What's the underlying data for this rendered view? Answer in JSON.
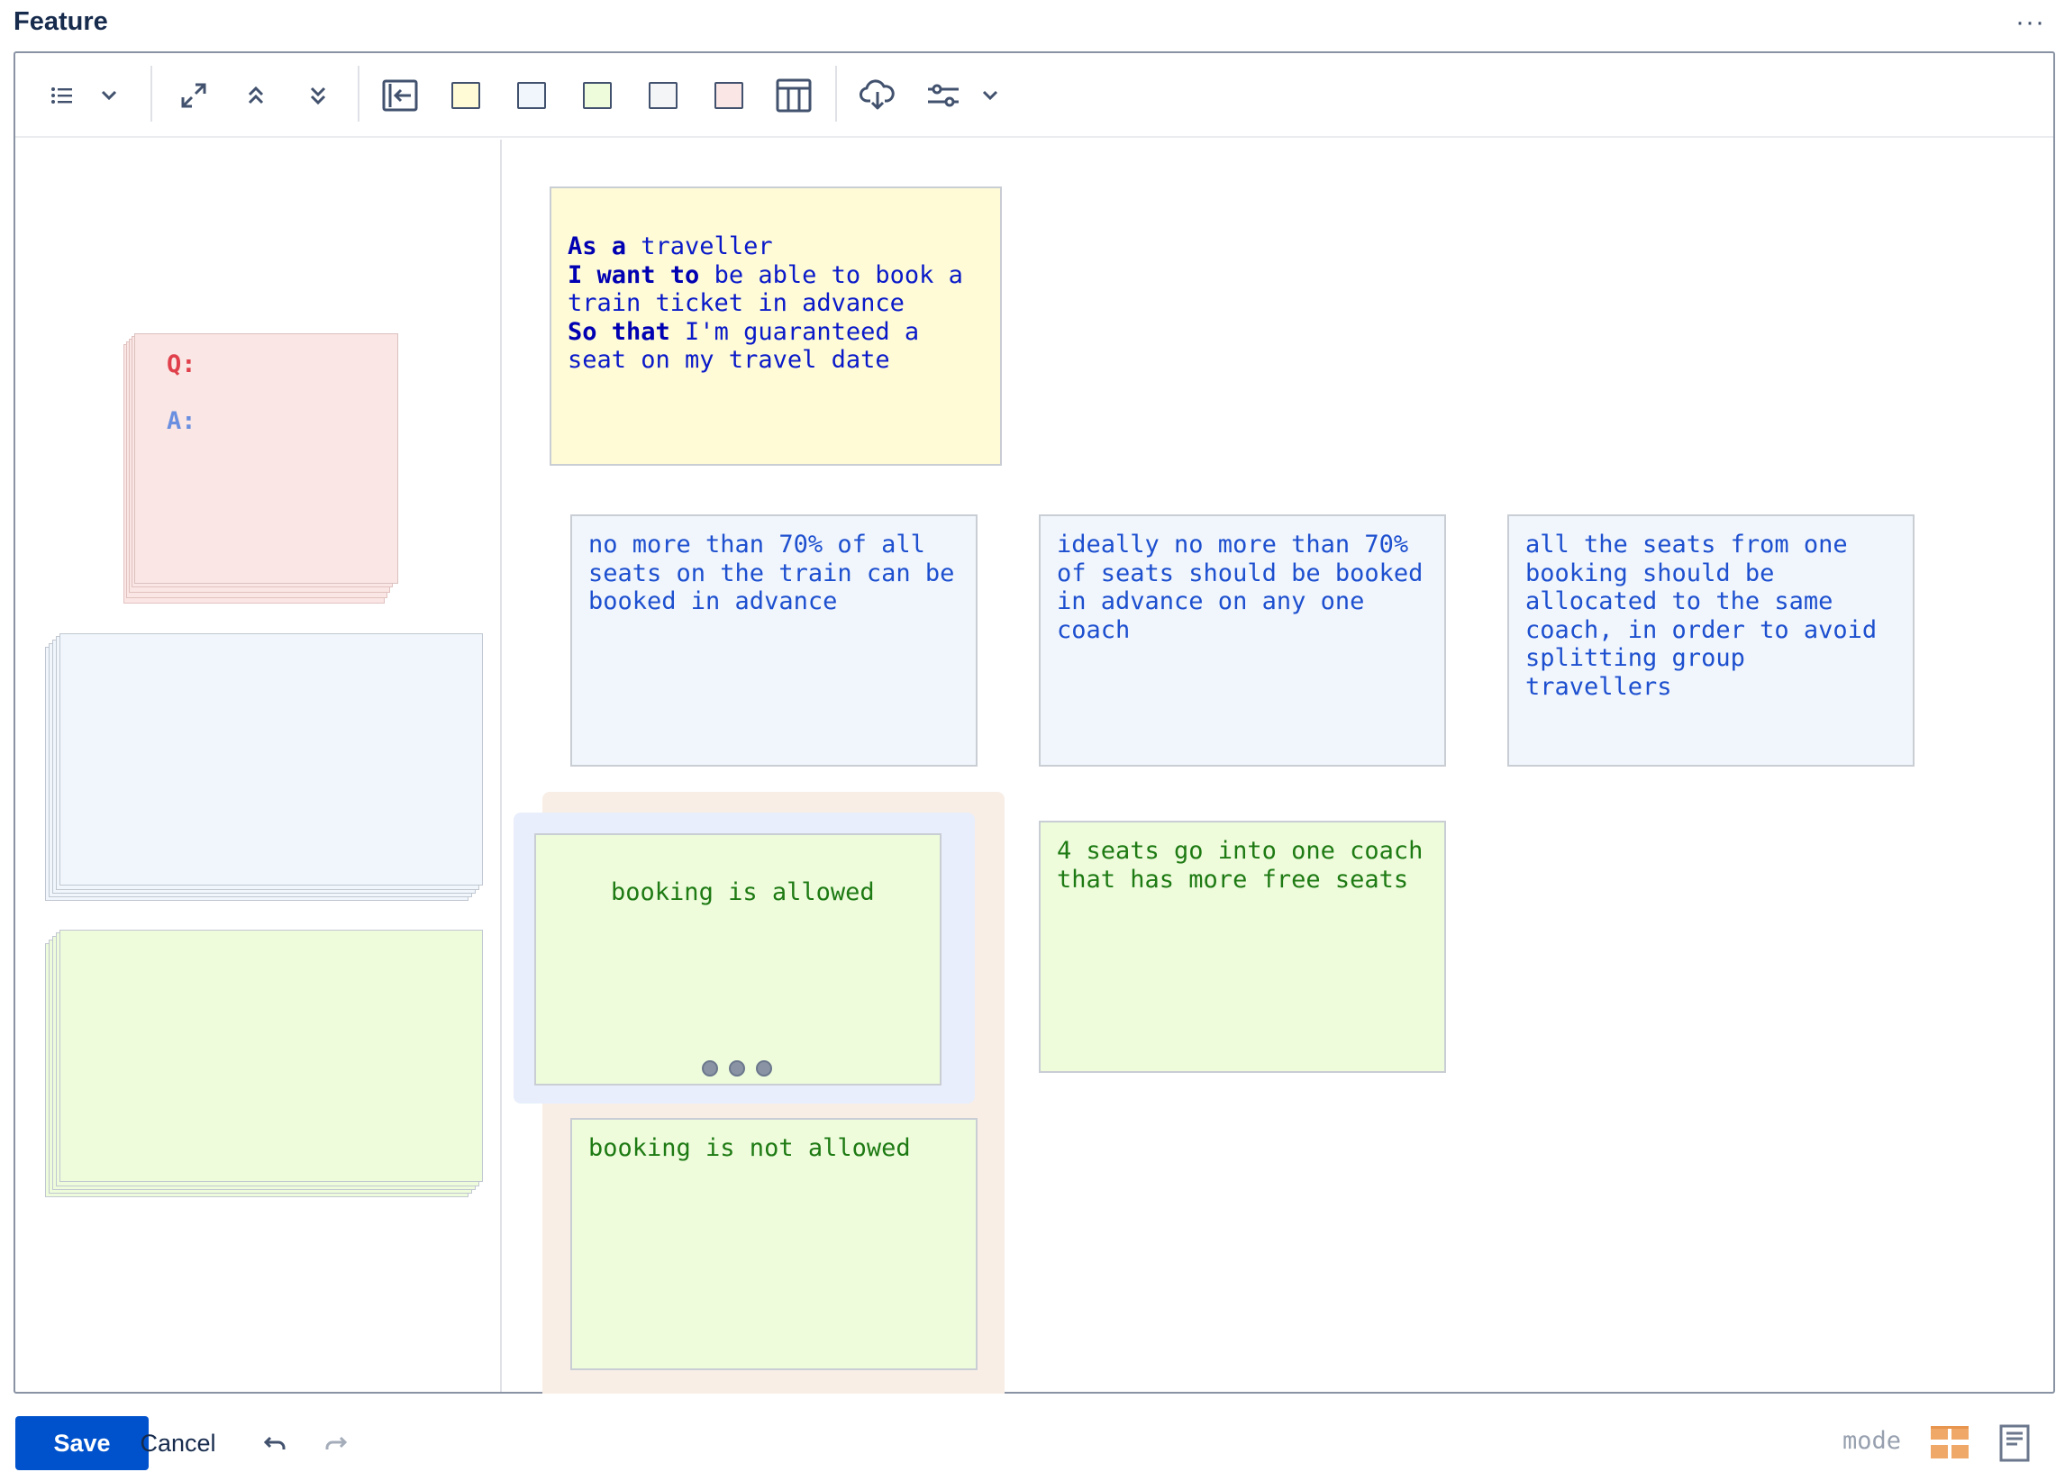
{
  "header": {
    "title": "Feature",
    "more_label": "···"
  },
  "toolbar": {
    "icons": [
      "list-icon",
      "chevron-down-icon",
      "expand-icon",
      "chevrons-up-icon",
      "chevrons-down-icon",
      "collapse-panel-icon",
      "swatch-yellow",
      "swatch-blue",
      "swatch-green",
      "swatch-white",
      "swatch-pink",
      "table-icon",
      "cloud-download-icon",
      "sliders-icon",
      "chevron-down-icon"
    ],
    "swatch_colors": {
      "yellow": "#fefbd6",
      "blue": "#f0f6fc",
      "green": "#eefcdc",
      "white": "#f4f5f7",
      "pink": "#fae6e4"
    }
  },
  "left_pane": {
    "question_label": "Q:",
    "answer_label": "A:",
    "question_color": "#e0404b",
    "answer_color": "#6a8fe0"
  },
  "story": {
    "as_a_kw": "As a",
    "as_a_text": " traveller",
    "i_want_kw": "I want to",
    "i_want_text": " be able to book a\ntrain ticket in advance",
    "so_that_kw": "So that",
    "so_that_text": " I'm guaranteed a\nseat on my travel date"
  },
  "rules": [
    {
      "text": "no more than 70% of all\nseats on the train can be\nbooked in advance"
    },
    {
      "text": "ideally no more than 70%\nof seats should be booked\nin advance on any one\ncoach"
    },
    {
      "text": "all the seats from one\nbooking should be\nallocated to the same\ncoach, in order to avoid\nsplitting group\ntravellers"
    }
  ],
  "examples": [
    {
      "text": "booking is allowed"
    },
    {
      "text": "booking is not allowed"
    },
    {
      "text": "4 seats go into one coach\nthat has more free seats"
    }
  ],
  "footer": {
    "save_label": "Save",
    "cancel_label": "Cancel",
    "mode_label": "mode"
  },
  "colors": {
    "accent": "#0052cc",
    "mode_active": "#f0a868",
    "group_bg": "#f8eee6",
    "selection_bg": "#e8eefb"
  }
}
